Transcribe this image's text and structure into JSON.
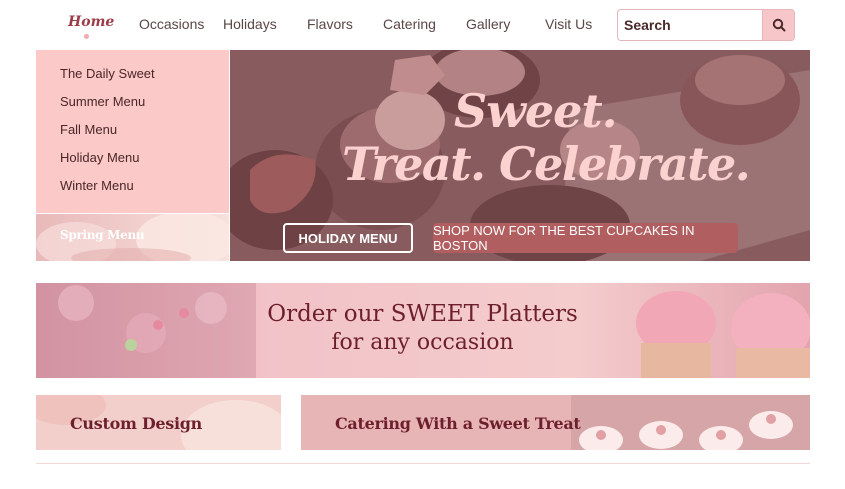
{
  "nav": {
    "home": "Home",
    "items": [
      "Occasions",
      "Holidays",
      "Flavors",
      "Catering",
      "Gallery",
      "Visit Us"
    ]
  },
  "search": {
    "placeholder": "Search",
    "icon": "search-icon"
  },
  "dropdown": {
    "items": [
      "The Daily Sweet",
      "Summer Menu",
      "Fall Menu",
      "Holiday Menu",
      "Winter Menu"
    ],
    "spring": "Spring Menu"
  },
  "hero": {
    "title_line1": "Sweet.",
    "title_line2": "Treat. Celebrate.",
    "holiday_button": "HOLIDAY MENU",
    "shop_button": "SHOP NOW FOR THE BEST CUPCAKES IN BOSTON"
  },
  "platters": {
    "line1": "Order our SWEET Platters",
    "line2": "for any occasion"
  },
  "tiles": {
    "custom": "Custom Design",
    "catering": "Catering With a Sweet Treat"
  },
  "colors": {
    "accent": "#9a3b47",
    "dropdown_bg": "#fcc9c9",
    "button_rose": "#b05e5f",
    "heading_maroon": "#6d1f2b"
  }
}
